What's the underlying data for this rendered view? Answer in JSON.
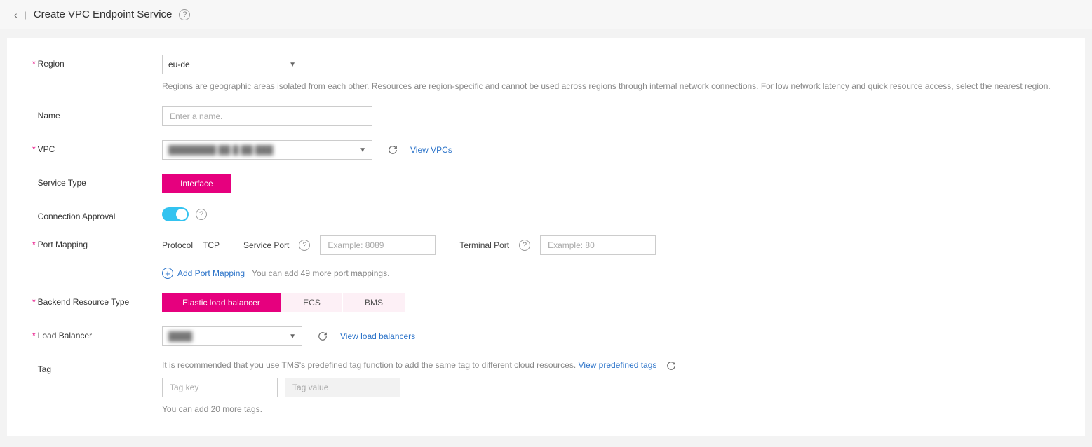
{
  "header": {
    "title": "Create VPC Endpoint Service"
  },
  "region": {
    "label": "Region",
    "value": "eu-de",
    "hint": "Regions are geographic areas isolated from each other. Resources are region-specific and cannot be used across regions through internal network connections. For low network latency and quick resource access, select the nearest region."
  },
  "name": {
    "label": "Name",
    "placeholder": "Enter a name."
  },
  "vpc": {
    "label": "VPC",
    "value": "████████ ██ █ ██ ███",
    "view_link": "View VPCs"
  },
  "service_type": {
    "label": "Service Type",
    "value": "Interface"
  },
  "connection_approval": {
    "label": "Connection Approval",
    "enabled": true
  },
  "port_mapping": {
    "label": "Port Mapping",
    "protocol_label": "Protocol",
    "protocol_value": "TCP",
    "service_port_label": "Service Port",
    "service_port_placeholder": "Example: 8089",
    "terminal_port_label": "Terminal Port",
    "terminal_port_placeholder": "Example: 80",
    "add_link": "Add Port Mapping",
    "add_hint": "You can add 49 more port mappings."
  },
  "backend_resource_type": {
    "label": "Backend Resource Type",
    "options": [
      "Elastic load balancer",
      "ECS",
      "BMS"
    ],
    "selected": "Elastic load balancer"
  },
  "load_balancer": {
    "label": "Load Balancer",
    "value": "████",
    "view_link": "View load balancers"
  },
  "tag": {
    "label": "Tag",
    "hint_prefix": "It is recommended that you use TMS's predefined tag function to add the same tag to different cloud resources. ",
    "view_link": "View predefined tags",
    "key_placeholder": "Tag key",
    "value_placeholder": "Tag value",
    "count_hint": "You can add 20 more tags."
  }
}
